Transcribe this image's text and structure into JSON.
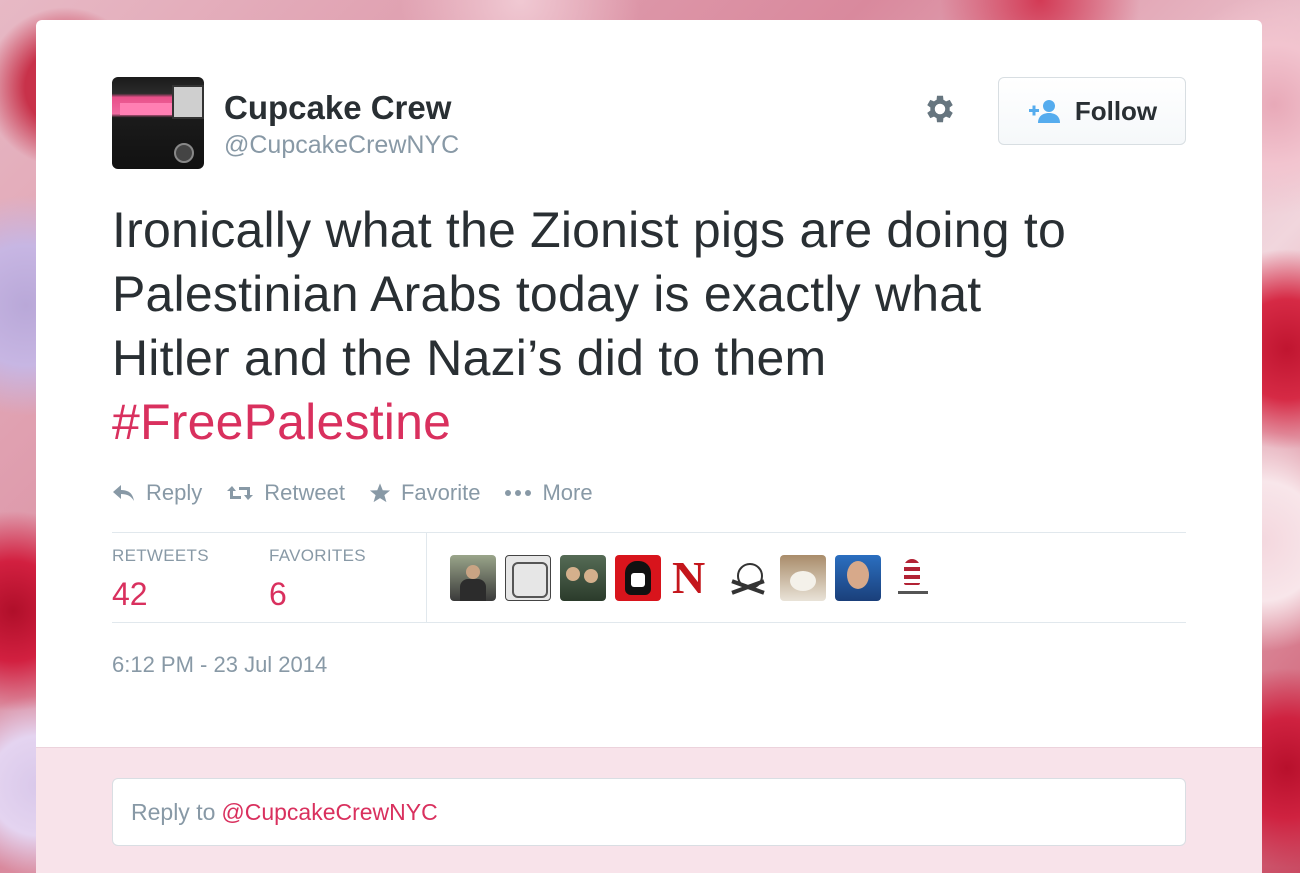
{
  "tweet": {
    "author_name": "Cupcake Crew",
    "author_handle": "@CupcakeCrewNYC",
    "text_lines": [
      "Ironically what the Zionist pigs are doing to",
      "Palestinian Arabs today is exactly what",
      "Hitler and the Nazi’s did to them"
    ],
    "hashtag": "#FreePalestine",
    "timestamp": "6:12 PM - 23 Jul 2014"
  },
  "header": {
    "follow_label": "Follow",
    "settings_icon": "gear-icon",
    "follow_icon": "add-user-icon"
  },
  "actions": {
    "reply": "Reply",
    "retweet": "Retweet",
    "favorite": "Favorite",
    "more": "More"
  },
  "stats": {
    "retweets_label": "RETWEETS",
    "retweets_value": "42",
    "favorites_label": "FAVORITES",
    "favorites_value": "6"
  },
  "reply": {
    "prefix": "Reply to",
    "mention": "@CupcakeCrewNYC"
  },
  "colors": {
    "accent": "#d9305e",
    "text": "#292f33",
    "muted": "#8899a6",
    "reply_bg": "#f8e3ea"
  }
}
